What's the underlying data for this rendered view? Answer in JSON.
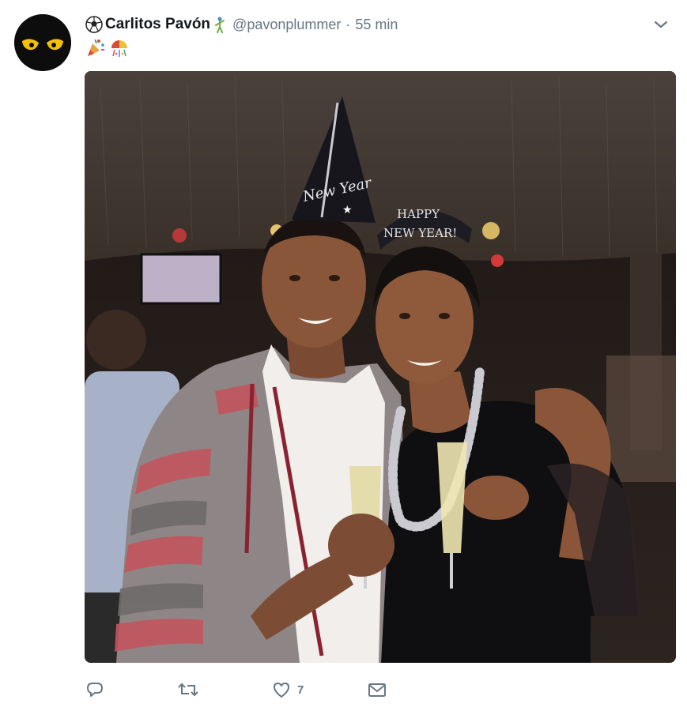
{
  "tweet": {
    "display_name": "Carlitos Pavón",
    "handle": "@pavonplummer",
    "separator": "·",
    "time": "55 min",
    "name_prefix_icon": "soccer-ball-icon",
    "name_suffix_icon": "golfer-icon",
    "text_icons": [
      "party-popper-icon",
      "confetti-ball-icon"
    ],
    "menu_icon": "chevron-down-icon"
  },
  "photo": {
    "hat_text": "New Year",
    "tiara_text_line1": "HAPPY",
    "tiara_text_line2": "NEW YEAR!"
  },
  "actions": {
    "reply_icon": "reply-icon",
    "retweet_icon": "retweet-icon",
    "like_icon": "heart-icon",
    "like_count": "7",
    "message_icon": "envelope-icon"
  },
  "colors": {
    "name": "#14171a",
    "secondary": "#657786",
    "avatar_bg": "#0d0d0d",
    "avatar_eyes": "#f2c200"
  }
}
